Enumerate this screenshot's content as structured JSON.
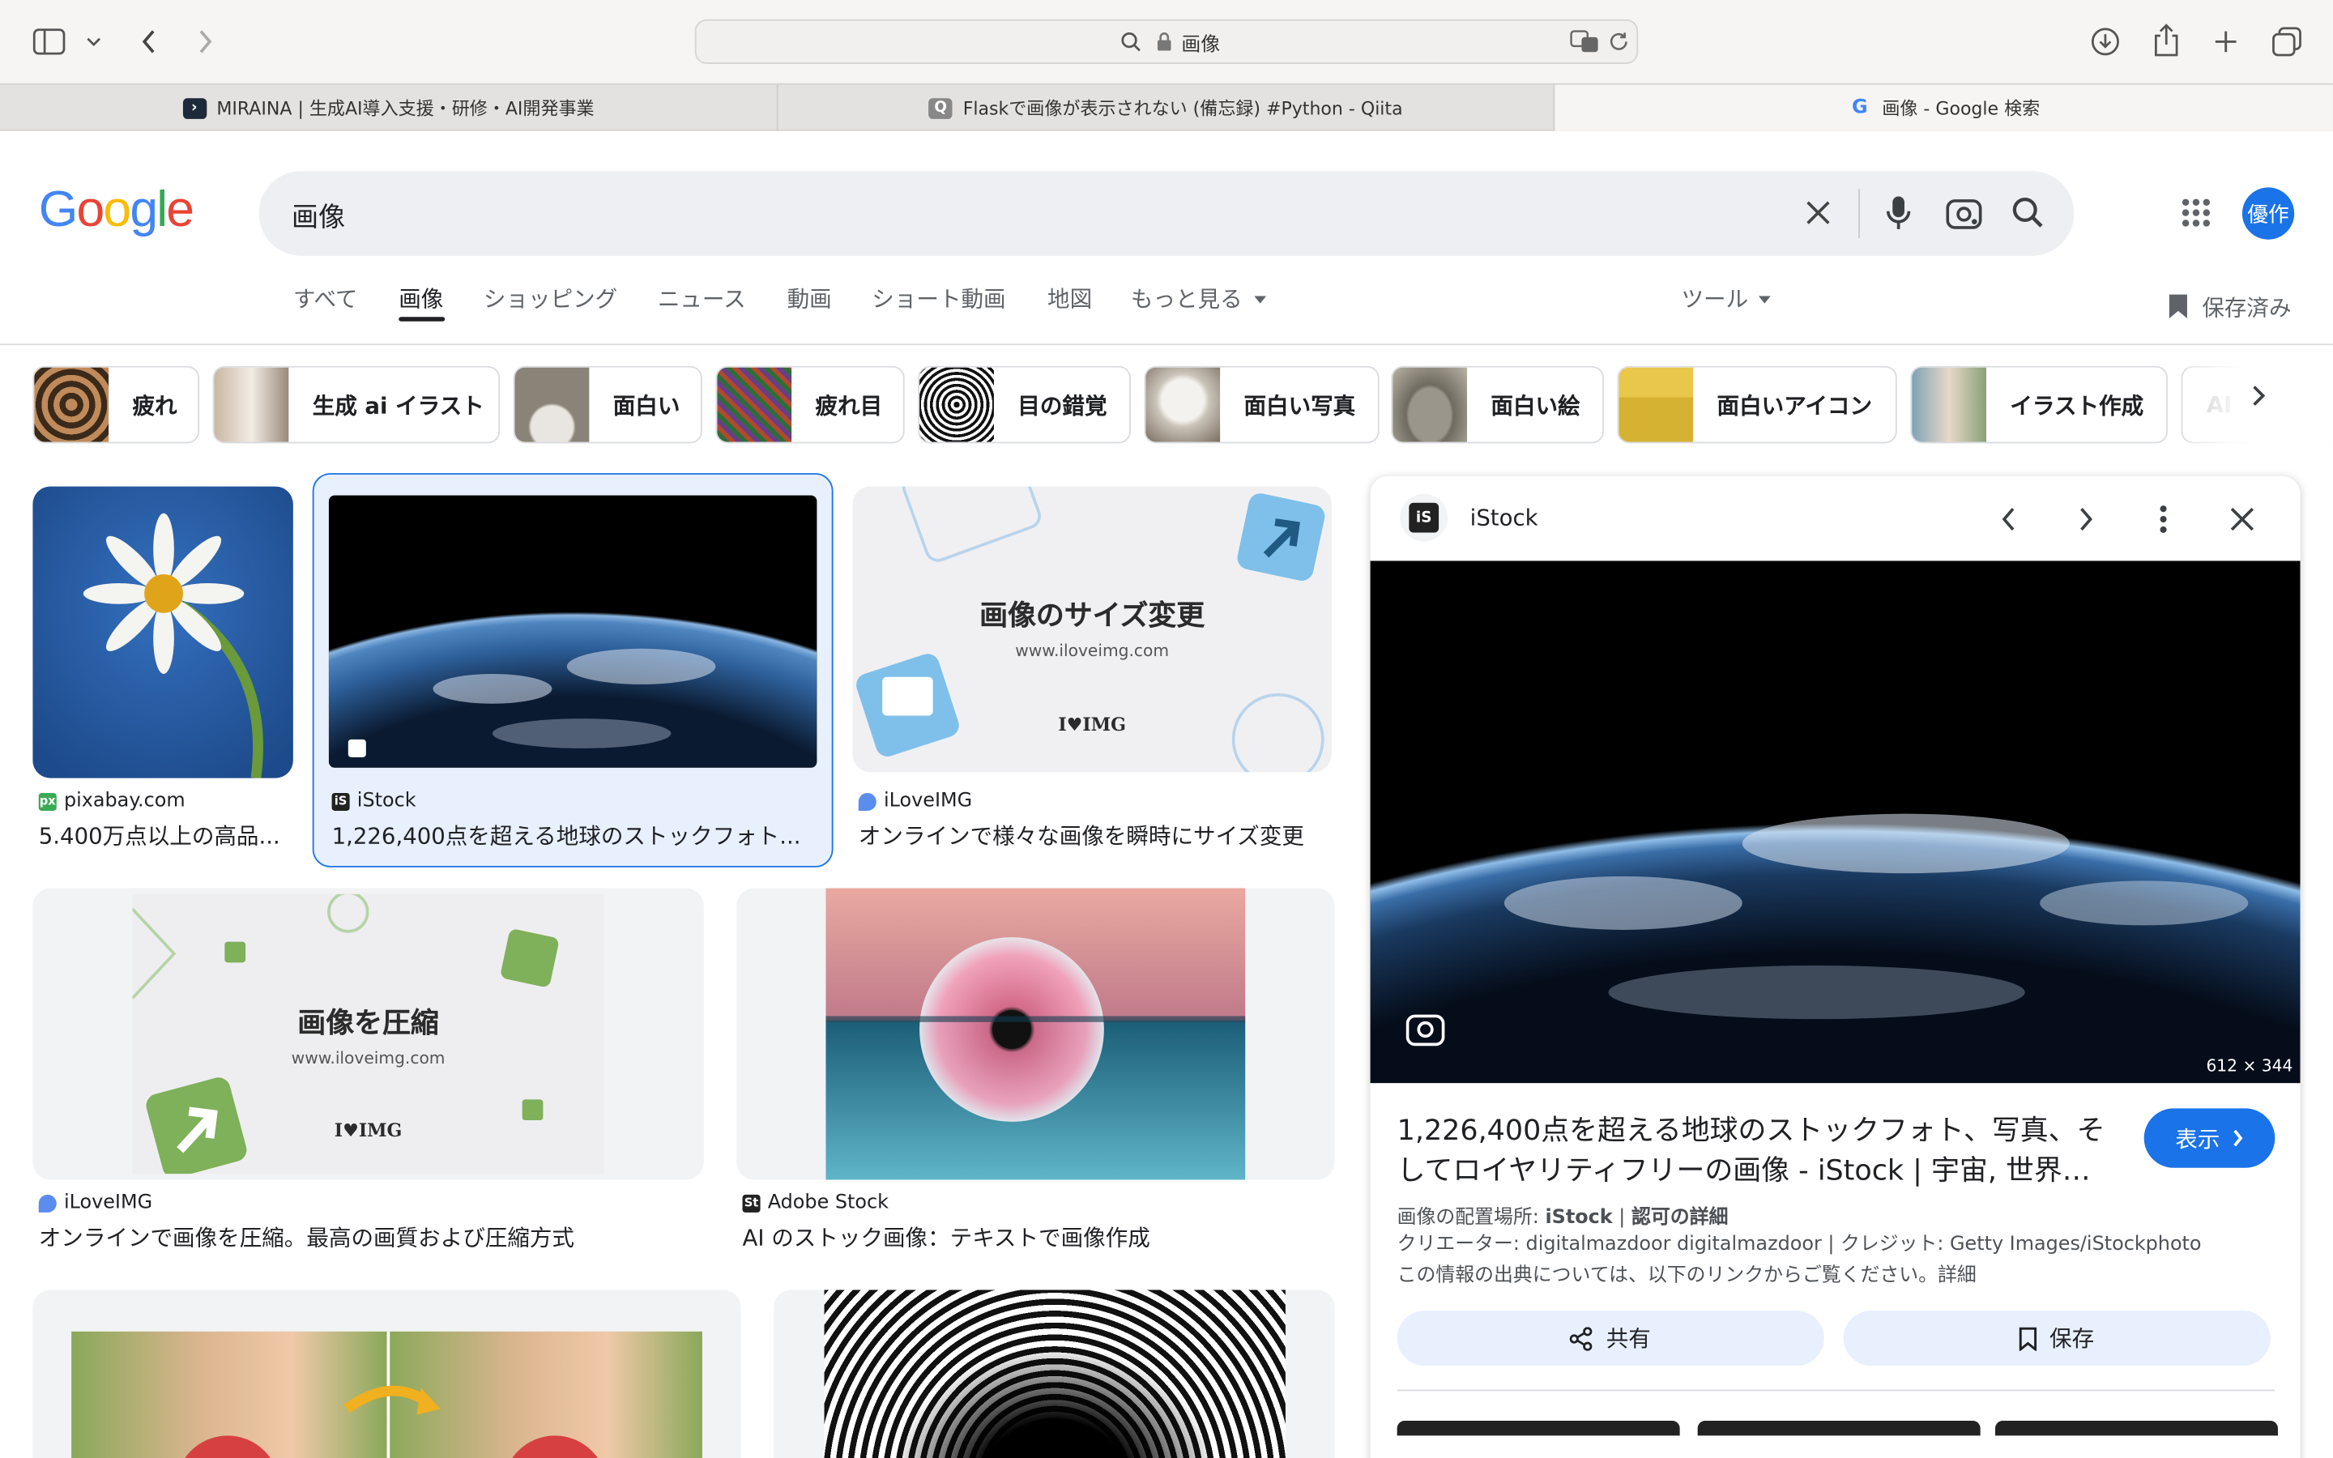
{
  "browser": {
    "address": "画像",
    "tabs": [
      {
        "title": "MIRAINA | 生成AI導入支援・研修・AI開発事業"
      },
      {
        "title": "Flaskで画像が表示されない (備忘録) #Python - Qiita"
      },
      {
        "title": "画像 - Google 検索"
      }
    ]
  },
  "google": {
    "logo": "Google",
    "query": "画像",
    "avatar": "優作",
    "nav": [
      "すべて",
      "画像",
      "ショッピング",
      "ニュース",
      "動画",
      "ショート動画",
      "地図",
      "もっと見る"
    ],
    "tools": "ツール",
    "saved": "保存済み"
  },
  "chips": [
    "疲れ",
    "生成 ai イラスト",
    "面白い",
    "疲れ目",
    "目の錯覚",
    "面白い写真",
    "面白い絵",
    "面白いアイコン",
    "イラスト作成",
    "AI"
  ],
  "results": [
    {
      "source": "pixabay.com",
      "title": "5.400万点以上の高品..."
    },
    {
      "source": "iStock",
      "title": "1,226,400点を超える地球のストックフォト..."
    },
    {
      "source": "iLoveIMG",
      "title": "オンラインで様々な画像を瞬時にサイズ変更",
      "image_heading": "画像のサイズ変更",
      "image_url": "www.iloveimg.com",
      "image_brand": "I♥IMG"
    },
    {
      "source": "iLoveIMG",
      "title": "オンラインで画像を圧縮。最高の画質および圧縮方式",
      "image_heading": "画像を圧縮",
      "image_url": "www.iloveimg.com",
      "image_brand": "I♥IMG"
    },
    {
      "source": "Adobe Stock",
      "title": "AI のストック画像：テキストで画像作成"
    }
  ],
  "panel": {
    "source": "iStock",
    "dimensions": "612 × 344",
    "title_line1": "1,226,400点を超える地球のストックフォト、写真、そ",
    "title_line2": "してロイヤリティフリーの画像 - iStock | 宇宙, 世界…",
    "visit": "表示",
    "meta_line1_prefix": "画像の配置場所: ",
    "meta_line1_source": "iStock",
    "meta_line1_sep": " | ",
    "meta_line1_license": "認可の詳細",
    "meta_line2": "クリエーター: digitalmazdoor digitalmazdoor | クレジット: Getty Images/iStockphoto",
    "meta_line3": "この情報の出典については、以下のリンクからご覧ください。詳細",
    "share": "共有",
    "save": "保存"
  },
  "colors": {
    "accent": "#1a73e8",
    "earth_blue": "#3a6ea8",
    "selected_bg": "#e8f0fe"
  }
}
